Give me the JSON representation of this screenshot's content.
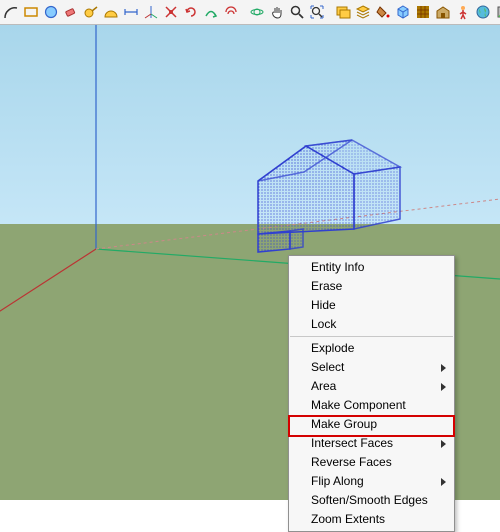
{
  "toolbar": {
    "icons": [
      "arc",
      "rectangle",
      "circle",
      "eraser",
      "tape",
      "protractor",
      "dimensions",
      "axes",
      "freehand",
      "rotate",
      "followme",
      "offset",
      "move",
      "pan",
      "zoom",
      "zoom-extents",
      "previous",
      "next",
      "paint",
      "component",
      "texture",
      "3dwarehouse",
      "person",
      "globe",
      "style"
    ]
  },
  "context_menu": {
    "items": [
      {
        "label": "Entity Info",
        "sub": false
      },
      {
        "label": "Erase",
        "sub": false
      },
      {
        "label": "Hide",
        "sub": false
      },
      {
        "label": "Lock",
        "sub": false
      },
      {
        "sep": true
      },
      {
        "label": "Explode",
        "sub": false
      },
      {
        "label": "Select",
        "sub": true
      },
      {
        "label": "Area",
        "sub": true
      },
      {
        "label": "Make Component",
        "sub": false
      },
      {
        "label": "Make Group",
        "sub": false,
        "highlight": true
      },
      {
        "label": "Intersect Faces",
        "sub": true
      },
      {
        "label": "Reverse Faces",
        "sub": false
      },
      {
        "label": "Flip Along",
        "sub": true
      },
      {
        "label": "Soften/Smooth Edges",
        "sub": false
      },
      {
        "label": "Zoom Extents",
        "sub": false
      }
    ]
  },
  "colors": {
    "axis_x": "#b33",
    "axis_y": "#2a6",
    "axis_z": "#36c",
    "select": "#3040d0"
  }
}
